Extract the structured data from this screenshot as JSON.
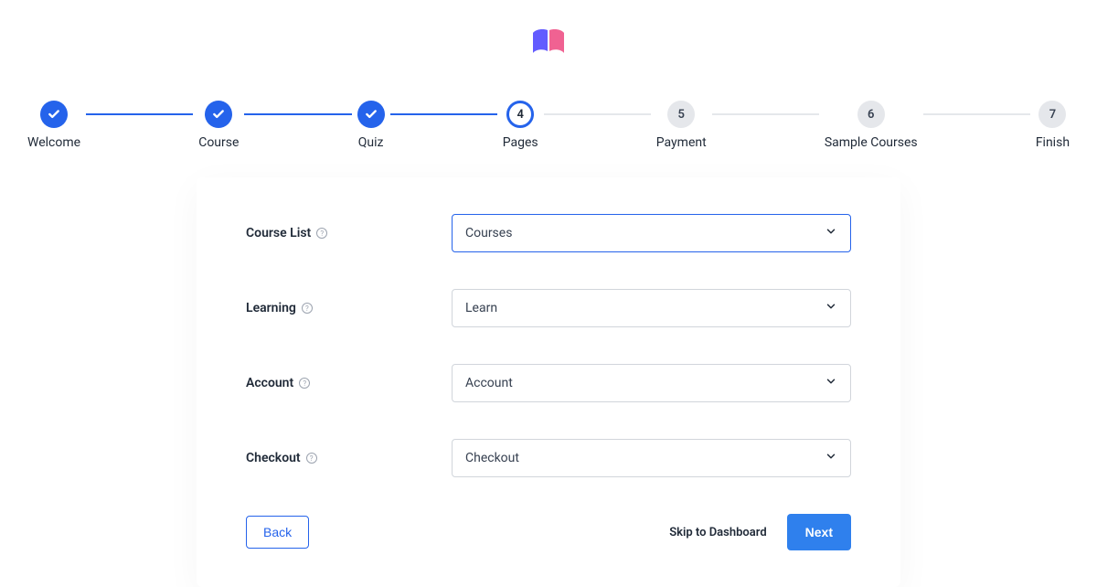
{
  "stepper": {
    "steps": [
      {
        "label": "Welcome",
        "state": "done"
      },
      {
        "label": "Course",
        "state": "done"
      },
      {
        "label": "Quiz",
        "state": "done"
      },
      {
        "label": "Pages",
        "state": "current",
        "num": "4"
      },
      {
        "label": "Payment",
        "state": "upcoming",
        "num": "5"
      },
      {
        "label": "Sample Courses",
        "state": "upcoming",
        "num": "6"
      },
      {
        "label": "Finish",
        "state": "upcoming",
        "num": "7"
      }
    ]
  },
  "form": {
    "rows": [
      {
        "label": "Course List",
        "value": "Courses",
        "focused": true
      },
      {
        "label": "Learning",
        "value": "Learn",
        "focused": false
      },
      {
        "label": "Account",
        "value": "Account",
        "focused": false
      },
      {
        "label": "Checkout",
        "value": "Checkout",
        "focused": false
      }
    ]
  },
  "buttons": {
    "back": "Back",
    "skip": "Skip to Dashboard",
    "next": "Next"
  }
}
